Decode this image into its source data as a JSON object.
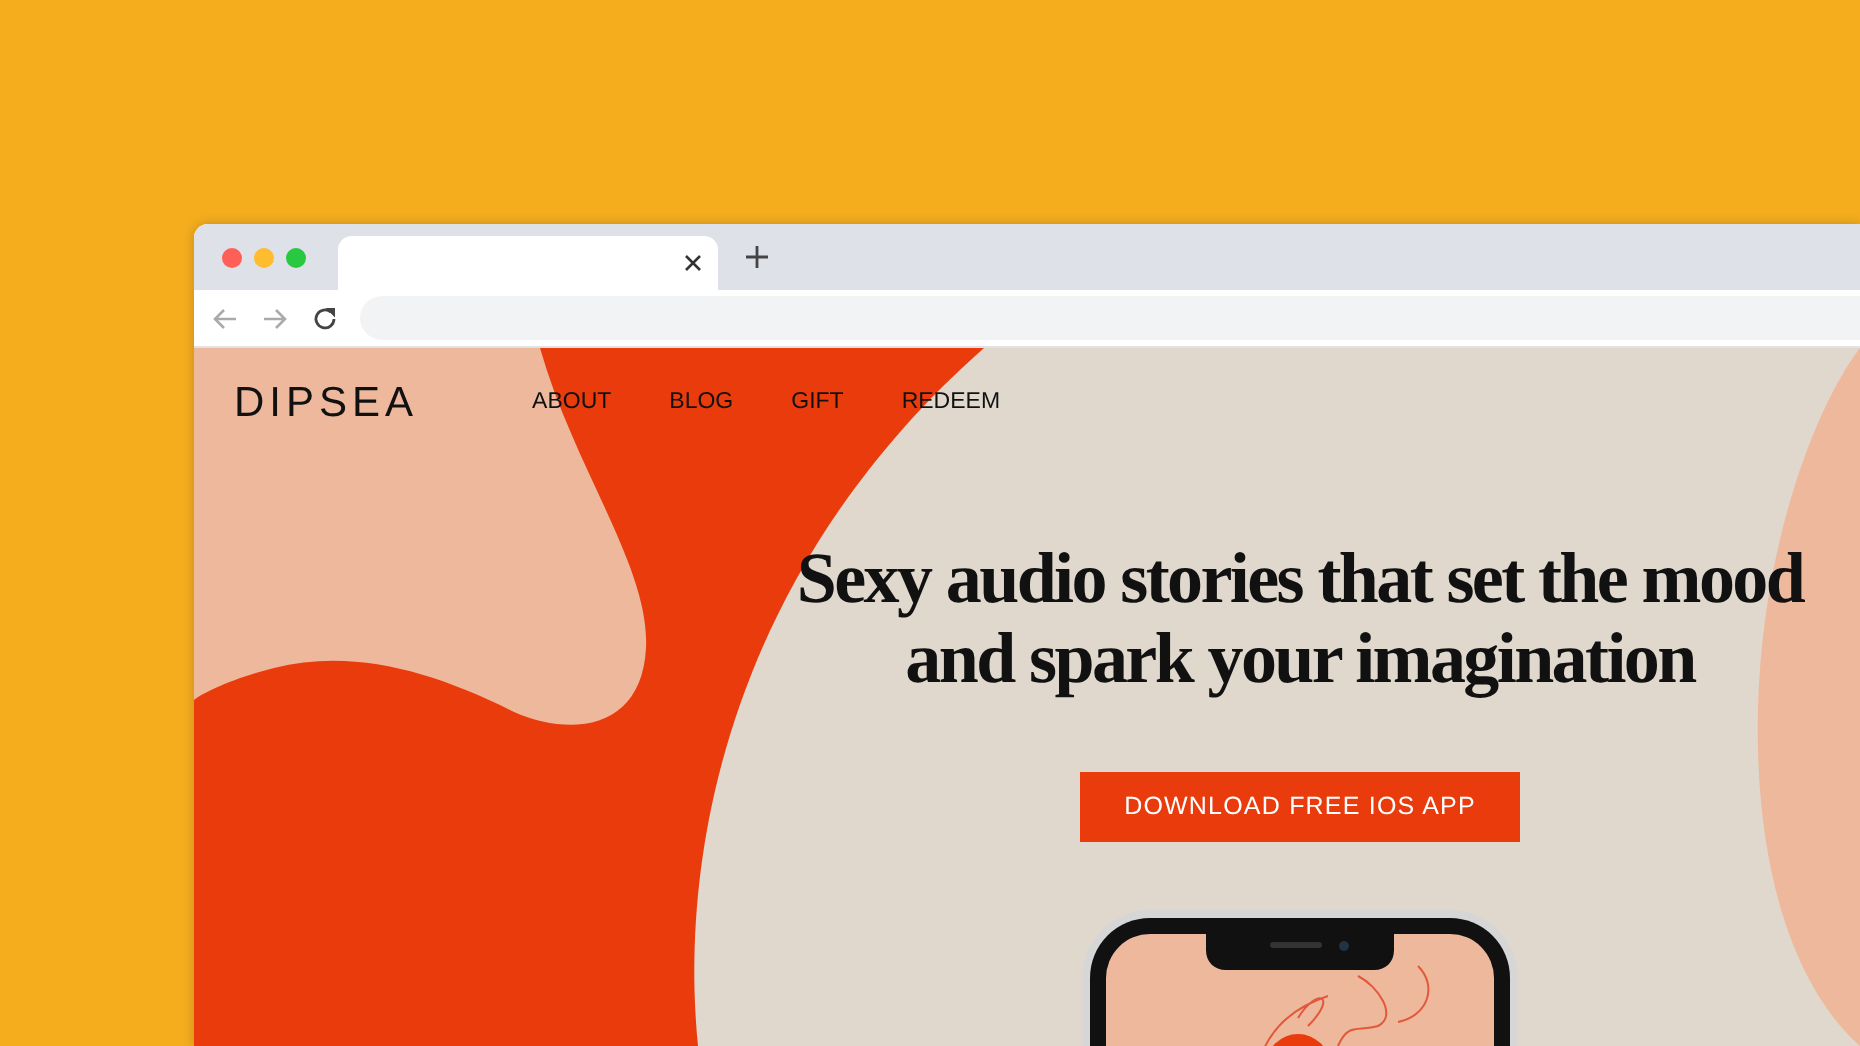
{
  "site": {
    "logo": "DIPSEA",
    "nav": [
      "ABOUT",
      "BLOG",
      "GIFT",
      "REDEEM"
    ]
  },
  "hero": {
    "headline": "Sexy audio stories that set the mood and spark your imagination",
    "button": "DOWNLOAD FREE IOS APP"
  }
}
